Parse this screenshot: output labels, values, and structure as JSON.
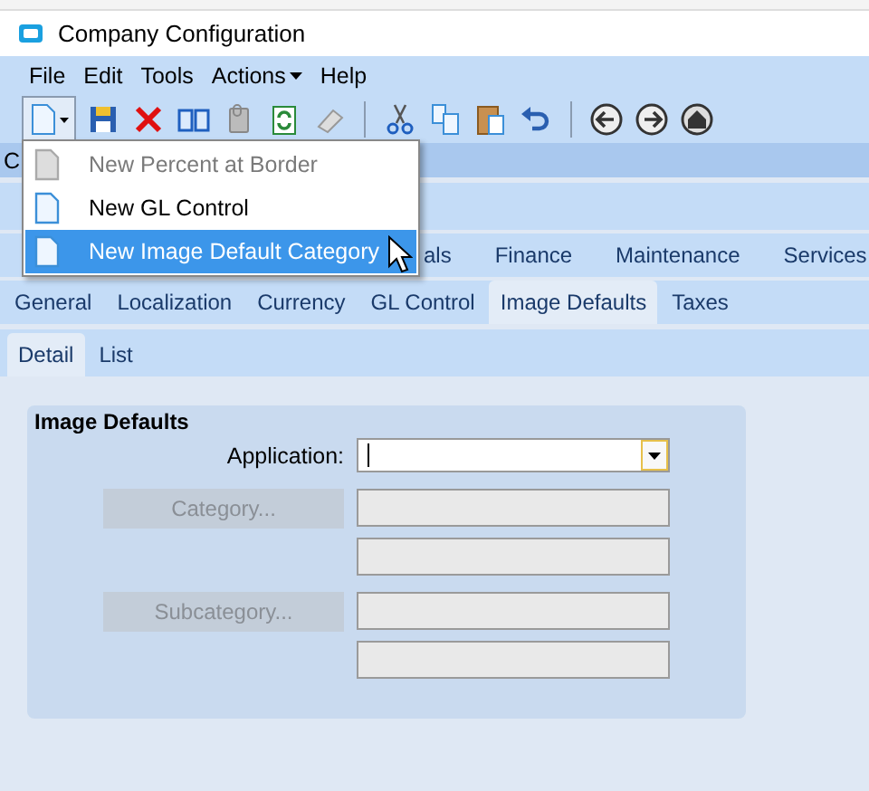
{
  "window": {
    "title": "Company Configuration"
  },
  "menu_bar": [
    {
      "label": "File",
      "dropdown": false
    },
    {
      "label": "Edit",
      "dropdown": false
    },
    {
      "label": "Tools",
      "dropdown": false
    },
    {
      "label": "Actions",
      "dropdown": true
    },
    {
      "label": "Help",
      "dropdown": false
    }
  ],
  "new_menu": [
    {
      "label": "New Percent at Border",
      "disabled": true,
      "selected": false
    },
    {
      "label": "New GL Control",
      "disabled": false,
      "selected": false
    },
    {
      "label": "New Image Default Category",
      "disabled": false,
      "selected": true
    }
  ],
  "section_header": "C",
  "main_tabs": [
    {
      "label": "als",
      "selected": false
    },
    {
      "label": "Finance",
      "selected": false
    },
    {
      "label": "Maintenance",
      "selected": false
    },
    {
      "label": "Services",
      "selected": false
    }
  ],
  "sub_tabs": [
    {
      "label": "General",
      "selected": false
    },
    {
      "label": "Localization",
      "selected": false
    },
    {
      "label": "Currency",
      "selected": false
    },
    {
      "label": "GL Control",
      "selected": false
    },
    {
      "label": "Image Defaults",
      "selected": true
    },
    {
      "label": "Taxes",
      "selected": false
    }
  ],
  "view_tabs": [
    {
      "label": "Detail",
      "selected": true
    },
    {
      "label": "List",
      "selected": false
    }
  ],
  "panel": {
    "title": "Image Defaults",
    "application_label": "Application:",
    "lookups": [
      {
        "label": "Category...",
        "disabled": true
      },
      {
        "label": "Subcategory...",
        "disabled": true
      }
    ]
  }
}
